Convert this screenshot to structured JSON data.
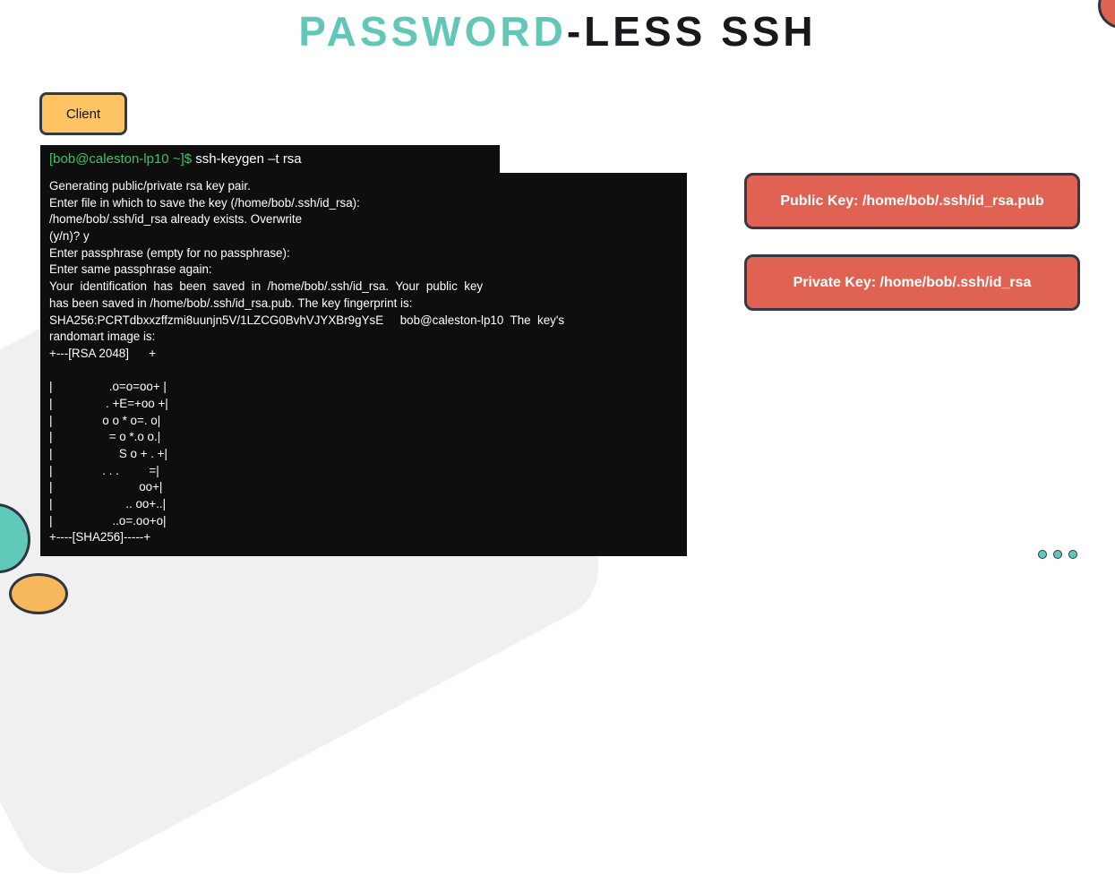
{
  "title": {
    "part1": "PASSWORD",
    "part2": "-LESS SSH"
  },
  "client_label": "Client",
  "terminal": {
    "prompt": "[bob@caleston-lp10 ~]$",
    "command": " ssh-keygen –t rsa",
    "lines": [
      "Generating public/private rsa key pair.",
      "Enter file in which to save the key (/home/bob/.ssh/id_rsa):",
      "/home/bob/.ssh/id_rsa already exists. Overwrite",
      "(y/n)? y",
      "Enter passphrase (empty for no passphrase):",
      "Enter same passphrase again:",
      "Your  identification  has  been  saved  in  /home/bob/.ssh/id_rsa.  Your  public  key",
      "has been saved in /home/bob/.ssh/id_rsa.pub. The key fingerprint is:",
      "SHA256:PCRTdbxxzffzmi8uunjn5V/1LZCG0BvhVJYXBr9gYsE     bob@caleston-lp10  The  key's",
      "randomart image is:",
      "+---[RSA 2048]      +",
      "",
      "|                 .o=o=oo+ |",
      "|                . +E=+oo +|",
      "|               o o * o=. o|",
      "|                 = o *.o o.|",
      "|                    S o + . +|",
      "|               . . .         =|",
      "|                          oo+|",
      "|                      .. oo+..|",
      "|                  ..o=.oo+o|",
      "+----[SHA256]-----+"
    ]
  },
  "public_key_label": "Public Key: /home/bob/.ssh/id_rsa.pub",
  "private_key_label": "Private Key: /home/bob/.ssh/id_rsa",
  "colors": {
    "accent_teal": "#63c7b8",
    "key_box": "#e06252",
    "client_button": "#fec463",
    "terminal_bg": "#0e0e0e",
    "prompt_green": "#39c36b"
  }
}
